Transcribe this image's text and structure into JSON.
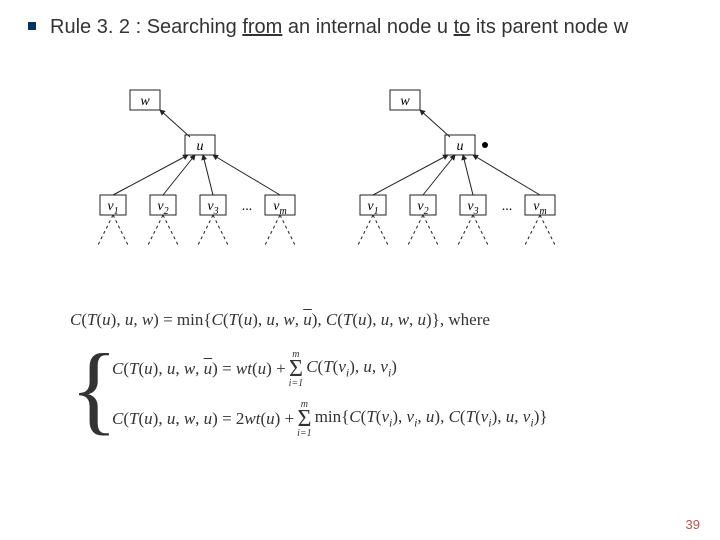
{
  "heading": {
    "rule_label": "Rule 3. 2 : Searching ",
    "from_word": "from",
    "mid_text": " an internal node u ",
    "to_word": "to",
    "end_text": " its parent node w"
  },
  "diagram": {
    "w": "w",
    "u": "u",
    "v1": "v",
    "v1_sub": "1",
    "v2": "v",
    "v2_sub": "2",
    "v3": "v",
    "v3_sub": "3",
    "vm": "v",
    "vm_sub": "m",
    "dots": "..."
  },
  "equations": {
    "main": "C(T(u), u, w) = min{C(T(u), u, w, u̅), C(T(u), u, w, u)}, where",
    "eq1_lhs": "C(T(u), u, w, u̅) = wt(u) + ",
    "eq1_sum": "Σ",
    "eq1_sum_top": "m",
    "eq1_sum_bot": "i=1",
    "eq1_rhs": " C(T(vᵢ), u, vᵢ)",
    "eq2_lhs": "C(T(u), u, w, u) = 2wt(u) + ",
    "eq2_sum": "Σ",
    "eq2_sum_top": "m",
    "eq2_sum_bot": "i=1",
    "eq2_rhs": " min{C(T(vᵢ), vᵢ, u), C(T(vᵢ), u, vᵢ)}"
  },
  "page_number": "39"
}
